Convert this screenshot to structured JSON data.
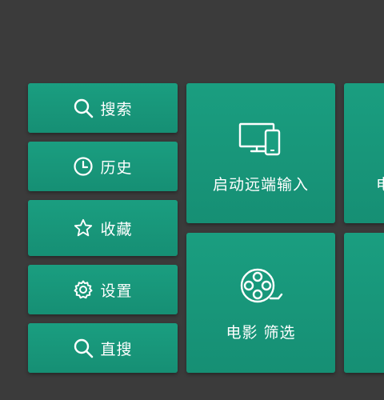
{
  "sidebar": {
    "items": [
      {
        "label": "搜索",
        "icon": "search-icon"
      },
      {
        "label": "历史",
        "icon": "clock-icon"
      },
      {
        "label": "收藏",
        "icon": "star-icon"
      },
      {
        "label": "设置",
        "icon": "gear-icon"
      },
      {
        "label": "直搜",
        "icon": "search-icon"
      }
    ]
  },
  "tiles": {
    "remote_input": {
      "label": "启动远端输入",
      "icon": "devices-icon"
    },
    "movie_filter": {
      "label": "电影 筛选",
      "icon": "film-reel-icon"
    },
    "peek_top": {
      "label": "电"
    }
  },
  "colors": {
    "background": "#3b3b3b",
    "tile": "#1a9e80",
    "text": "#ffffff"
  }
}
